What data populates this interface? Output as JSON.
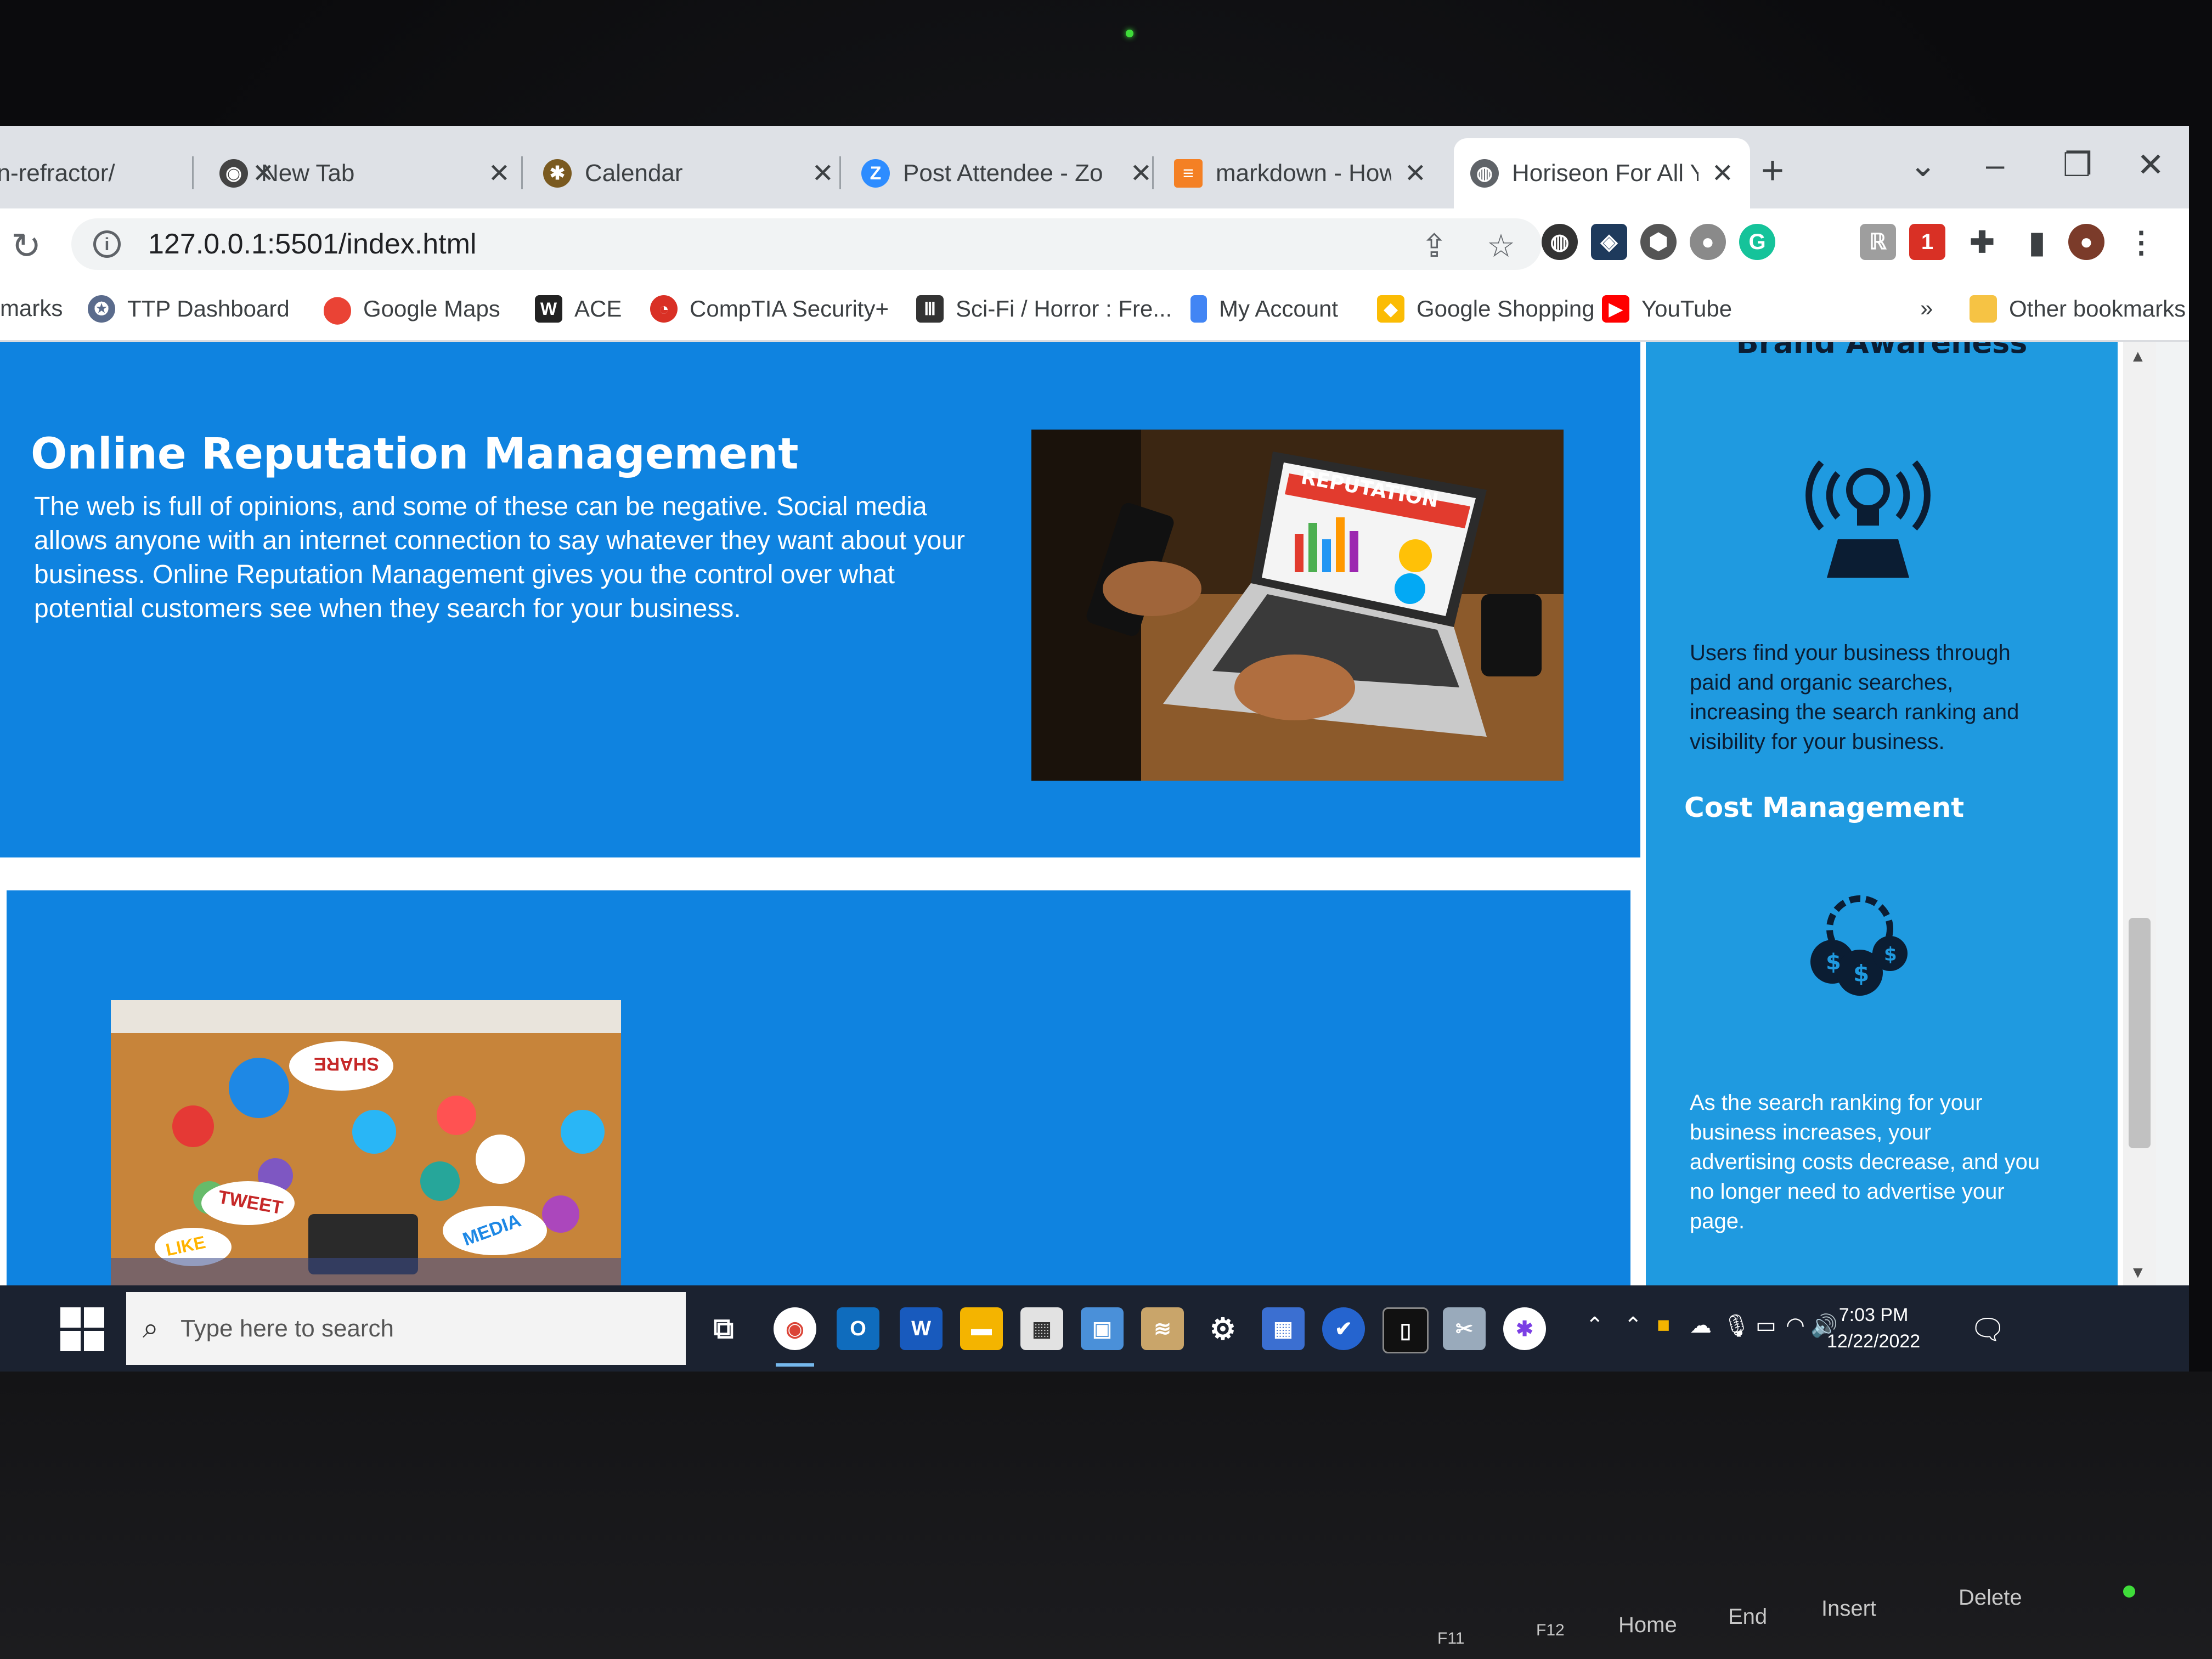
{
  "browser": {
    "tabs": [
      {
        "title": "on-refractor/",
        "favicon": "github-icon",
        "active": false
      },
      {
        "title": "New Tab",
        "favicon": "chrome-icon",
        "active": false
      },
      {
        "title": "Calendar",
        "favicon": "calendar-icon",
        "active": false
      },
      {
        "title": "Post Attendee - Zo",
        "favicon": "zoom-icon",
        "active": false
      },
      {
        "title": "markdown - How t",
        "favicon": "stackoverflow-icon",
        "active": false
      },
      {
        "title": "Horiseon For All Yo",
        "favicon": "globe-icon",
        "active": true
      }
    ],
    "new_tab_symbol": "+",
    "url": "127.0.0.1:5501/index.html",
    "bookmarks": [
      {
        "label": "marks",
        "icon": ""
      },
      {
        "label": "TTP Dashboard",
        "icon": "ttp-icon"
      },
      {
        "label": "Google Maps",
        "icon": "maps-pin-icon"
      },
      {
        "label": "ACE",
        "icon": "w-icon"
      },
      {
        "label": "CompTIA Security+",
        "icon": "pie-icon"
      },
      {
        "label": "Sci-Fi / Horror : Fre...",
        "icon": "building-icon"
      },
      {
        "label": "My Account",
        "icon": "bookmark-icon"
      },
      {
        "label": "Google Shopping",
        "icon": "shopping-icon"
      },
      {
        "label": "YouTube",
        "icon": "youtube-icon"
      }
    ],
    "overflow": "»",
    "other_bookmarks": "Other bookmarks"
  },
  "page": {
    "section_orm": {
      "heading": "Online Reputation Management",
      "text": "The web is full of opinions, and some of these can be negative. Social media allows anyone with an internet connection to say whatever they want about your business. Online Reputation Management gives you the control over what potential customers see when they search for your business.",
      "image_label": "REPUTATION"
    },
    "section_social": {
      "image_words": [
        "SHARE",
        "TWEET",
        "LIKE",
        "MEDIA"
      ]
    },
    "sidebar": {
      "cut_heading": "Brand Awareness",
      "brand_text": "Users find your business through paid and organic searches, increasing the search ranking and visibility for your business.",
      "cost_heading": "Cost Management",
      "cost_text": "As the search ranking for your business increases, your advertising costs decrease, and you no longer need to advertise your page."
    }
  },
  "taskbar": {
    "search_placeholder": "Type here to search",
    "time": "7:03 PM",
    "date": "12/22/2022"
  },
  "keyboard": {
    "keys": [
      "Home",
      "End",
      "Insert",
      "Delete",
      "F11",
      "F12"
    ]
  },
  "colors": {
    "section_blue": "#0f83e0",
    "sidebar_blue": "#1f9ae0",
    "taskbar": "#1b2230"
  }
}
